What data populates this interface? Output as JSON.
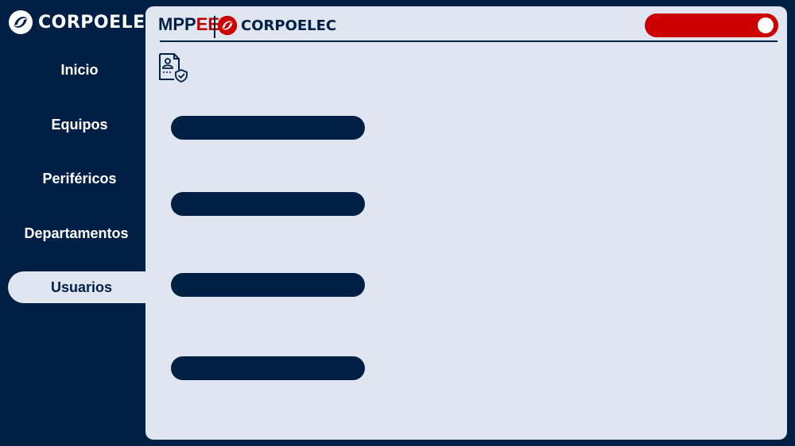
{
  "brand": {
    "name": "CORPOELEC",
    "logo_icon": "corpoelec-swirl-icon"
  },
  "sidebar": {
    "items": [
      {
        "label": "Inicio",
        "active": false
      },
      {
        "label": "Equipos",
        "active": false
      },
      {
        "label": "Periféricos",
        "active": false
      },
      {
        "label": "Departamentos",
        "active": false
      },
      {
        "label": "Usuarios",
        "active": true
      }
    ]
  },
  "header": {
    "ministry_part1": "MPP",
    "ministry_part2": "EE",
    "company": "CORPOELEC",
    "toggle_state": "on"
  },
  "main": {
    "page_icon": "user-document-shield-icon",
    "fields": [
      {
        "name": "field-1",
        "value": ""
      },
      {
        "name": "field-2",
        "value": ""
      },
      {
        "name": "field-3",
        "value": ""
      },
      {
        "name": "field-4",
        "value": ""
      }
    ]
  },
  "colors": {
    "navy": "#001f45",
    "panel": "#dfe6f0",
    "red": "#cc0000",
    "white": "#ffffff"
  }
}
